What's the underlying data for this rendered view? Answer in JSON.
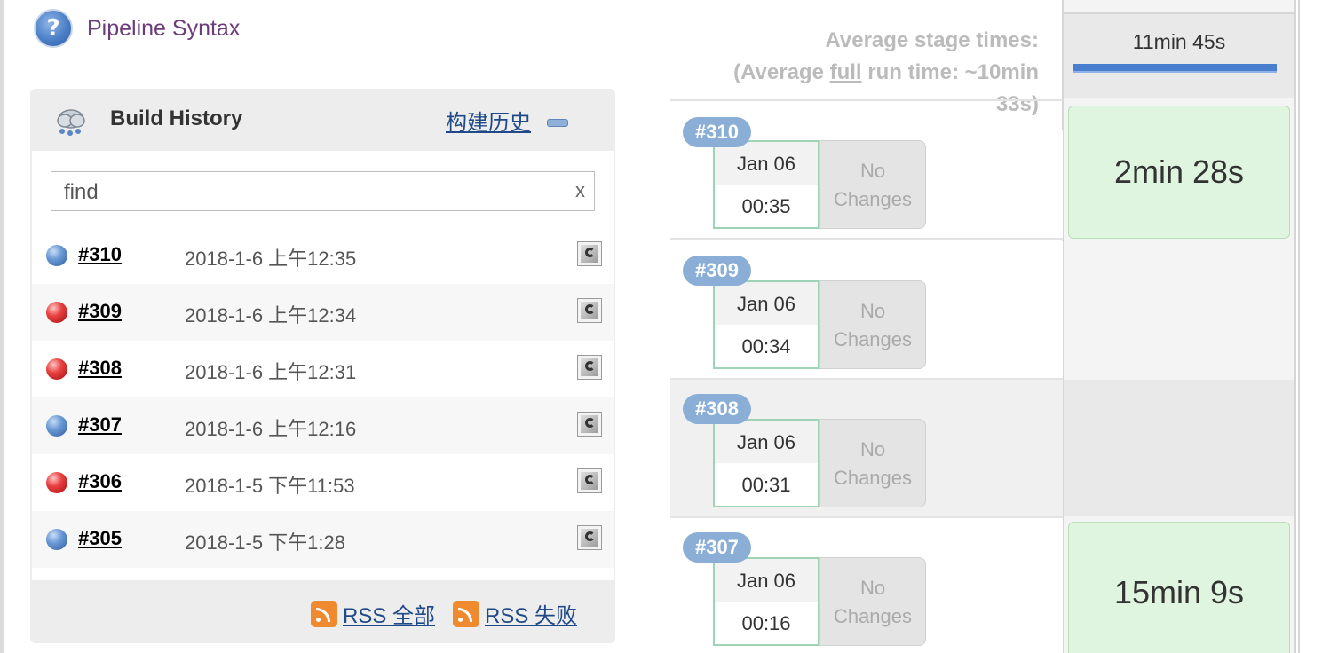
{
  "pipeline_syntax": {
    "icon": "help-icon",
    "label": "Pipeline Syntax"
  },
  "build_history": {
    "title": "Build History",
    "trend_link": "构建历史",
    "search": {
      "value": "",
      "placeholder": "find",
      "clear": "x"
    },
    "builds": [
      {
        "number": "#310",
        "time": "2018-1-6 上午12:35",
        "status": "success",
        "color": "#4a7fc7"
      },
      {
        "number": "#309",
        "time": "2018-1-6 上午12:34",
        "status": "failed",
        "color": "#e02b2b"
      },
      {
        "number": "#308",
        "time": "2018-1-6 上午12:31",
        "status": "failed",
        "color": "#e02b2b"
      },
      {
        "number": "#307",
        "time": "2018-1-6 上午12:16",
        "status": "success",
        "color": "#4a7fc7"
      },
      {
        "number": "#306",
        "time": "2018-1-5 下午11:53",
        "status": "failed",
        "color": "#e02b2b"
      },
      {
        "number": "#305",
        "time": "2018-1-5 下午1:28",
        "status": "success",
        "color": "#4a7fc7"
      }
    ],
    "rss_all": "RSS 全部",
    "rss_failed": "RSS 失败"
  },
  "stage_view": {
    "avg_stage_label": "Average stage times:",
    "avg_full_prefix": "(Average ",
    "avg_full_word": "full",
    "avg_full_suffix": " run time: ~10min",
    "avg_full_line2": "33s)",
    "stage_average": "11min 45s",
    "runs": [
      {
        "badge": "#310",
        "date": "Jan 06",
        "time": "00:35",
        "changes_line1": "No",
        "changes_line2": "Changes",
        "stage_time": "2min 28s"
      },
      {
        "badge": "#309",
        "date": "Jan 06",
        "time": "00:34",
        "changes_line1": "No",
        "changes_line2": "Changes",
        "stage_time": ""
      },
      {
        "badge": "#308",
        "date": "Jan 06",
        "time": "00:31",
        "changes_line1": "No",
        "changes_line2": "Changes",
        "stage_time": ""
      },
      {
        "badge": "#307",
        "date": "Jan 06",
        "time": "00:16",
        "changes_line1": "No",
        "changes_line2": "Changes",
        "stage_time": "15min 9s"
      }
    ]
  }
}
